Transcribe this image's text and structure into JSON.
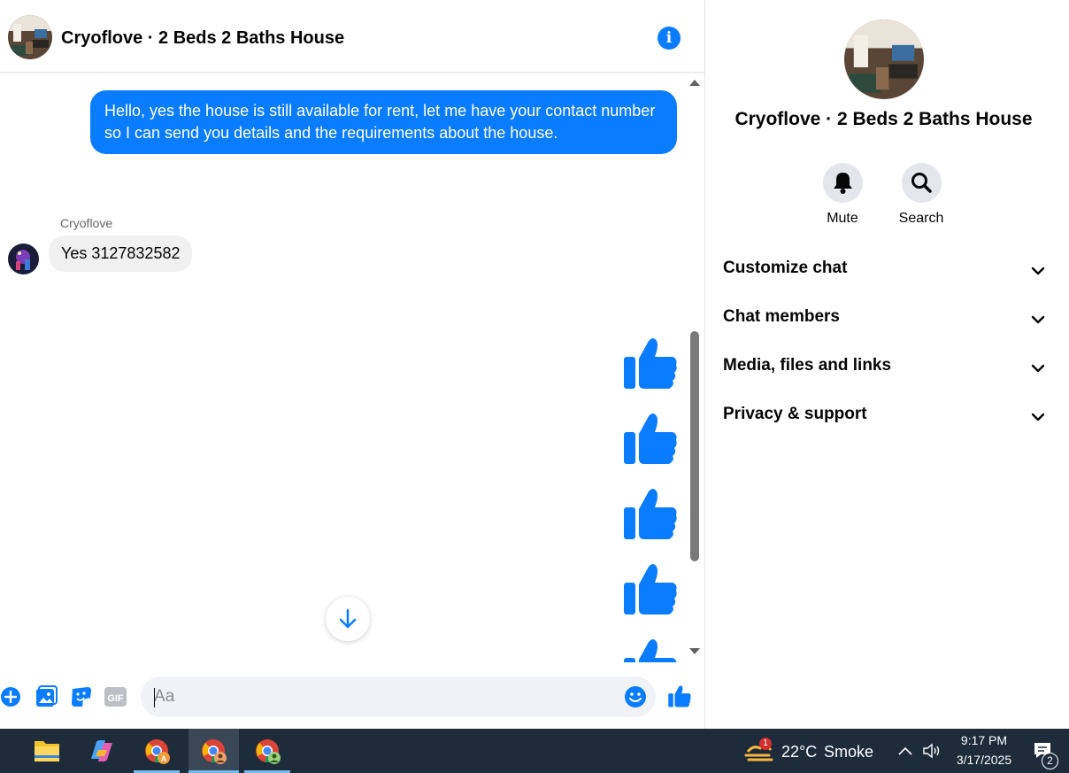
{
  "chat": {
    "title": "Cryoflove · 2 Beds 2 Baths House",
    "messages": {
      "outgoing_1": "Hello, yes the house is still available for rent, let me have your contact number so I can send you details and the requirements about the house.",
      "sender_name": "Cryoflove",
      "incoming_1": "Yes 3127832582",
      "thumbs_count": 5
    },
    "composer": {
      "placeholder": "Aa"
    }
  },
  "details": {
    "title": "Cryoflove · 2 Beds 2 Baths House",
    "actions": [
      {
        "label": "Mute",
        "icon": "bell-icon"
      },
      {
        "label": "Search",
        "icon": "search-icon"
      }
    ],
    "sections": [
      {
        "label": "Customize chat"
      },
      {
        "label": "Chat members"
      },
      {
        "label": "Media, files and links"
      },
      {
        "label": "Privacy & support"
      }
    ]
  },
  "taskbar": {
    "weather": {
      "temp": "22°C",
      "condition": "Smoke",
      "badge": "1"
    },
    "time": "9:17 PM",
    "date": "3/17/2025",
    "notifications": "2"
  },
  "colors": {
    "accent": "#0a7cff",
    "taskbar": "#1d2b3b"
  }
}
